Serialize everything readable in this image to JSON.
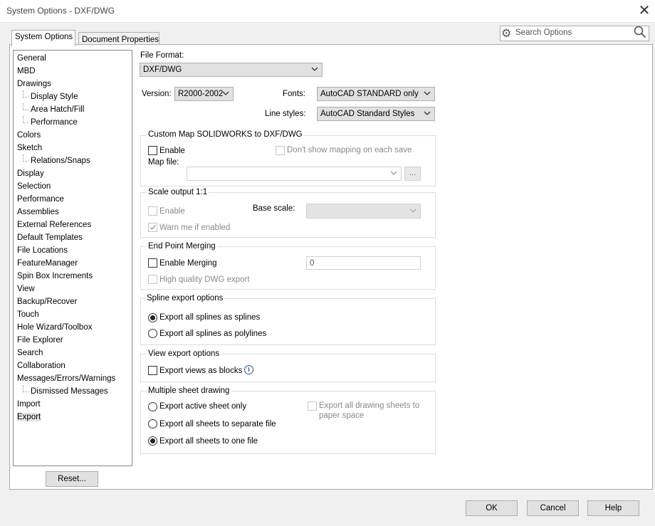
{
  "window": {
    "title": "System Options - DXF/DWG",
    "close_icon": "close-icon"
  },
  "tabs": [
    {
      "label": "System Options"
    },
    {
      "label": "Document Properties"
    }
  ],
  "search": {
    "placeholder": "Search Options",
    "icon_left": "gear-icon",
    "icon_right": "search-icon"
  },
  "tree": {
    "items": [
      {
        "label": "General",
        "level": 0
      },
      {
        "label": "MBD",
        "level": 0
      },
      {
        "label": "Drawings",
        "level": 0
      },
      {
        "label": "Display Style",
        "level": 1
      },
      {
        "label": "Area Hatch/Fill",
        "level": 1
      },
      {
        "label": "Performance",
        "level": 1
      },
      {
        "label": "Colors",
        "level": 0
      },
      {
        "label": "Sketch",
        "level": 0
      },
      {
        "label": "Relations/Snaps",
        "level": 1
      },
      {
        "label": "Display",
        "level": 0
      },
      {
        "label": "Selection",
        "level": 0
      },
      {
        "label": "Performance",
        "level": 0
      },
      {
        "label": "Assemblies",
        "level": 0
      },
      {
        "label": "External References",
        "level": 0
      },
      {
        "label": "Default Templates",
        "level": 0
      },
      {
        "label": "File Locations",
        "level": 0
      },
      {
        "label": "FeatureManager",
        "level": 0
      },
      {
        "label": "Spin Box Increments",
        "level": 0
      },
      {
        "label": "View",
        "level": 0
      },
      {
        "label": "Backup/Recover",
        "level": 0
      },
      {
        "label": "Touch",
        "level": 0
      },
      {
        "label": "Hole Wizard/Toolbox",
        "level": 0
      },
      {
        "label": "File Explorer",
        "level": 0
      },
      {
        "label": "Search",
        "level": 0
      },
      {
        "label": "Collaboration",
        "level": 0
      },
      {
        "label": "Messages/Errors/Warnings",
        "level": 0
      },
      {
        "label": "Dismissed Messages",
        "level": 1
      },
      {
        "label": "Import",
        "level": 0
      },
      {
        "label": "Export",
        "level": 0,
        "selected": true
      }
    ]
  },
  "reset_button": "Reset...",
  "file_format": {
    "label": "File Format:",
    "value": "DXF/DWG"
  },
  "version": {
    "label": "Version:",
    "value": "R2000-2002"
  },
  "fonts": {
    "label": "Fonts:",
    "value": "AutoCAD STANDARD only"
  },
  "line_styles": {
    "label": "Line styles:",
    "value": "AutoCAD Standard Styles"
  },
  "custom_map": {
    "title": "Custom Map SOLIDWORKS to DXF/DWG",
    "enable_label": "Enable",
    "dont_show_label": "Don't show mapping on each save",
    "map_file_label": "Map file:",
    "map_file_value": "",
    "browse_label": "..."
  },
  "scale_output": {
    "title": "Scale output 1:1",
    "enable_label": "Enable",
    "base_scale_label": "Base scale:",
    "base_scale_value": "",
    "warn_label": "Warn me if enabled"
  },
  "end_point": {
    "title": "End Point Merging",
    "enable_label": "Enable Merging",
    "value": "0",
    "high_quality_label": "High quality DWG export"
  },
  "spline": {
    "title": "Spline export options",
    "opt1": "Export all splines as splines",
    "opt2": "Export all splines as polylines"
  },
  "view_export": {
    "title": "View export options",
    "blocks_label": "Export views as blocks",
    "info_icon": "info-icon"
  },
  "multi_sheet": {
    "title": "Multiple sheet drawing",
    "opt1": "Export active sheet only",
    "opt2": "Export all sheets to separate file",
    "opt3": "Export all sheets to one file",
    "paper_space_line1": "Export all drawing sheets to",
    "paper_space_line2": "paper space"
  },
  "footer": {
    "ok": "OK",
    "cancel": "Cancel",
    "help": "Help"
  }
}
